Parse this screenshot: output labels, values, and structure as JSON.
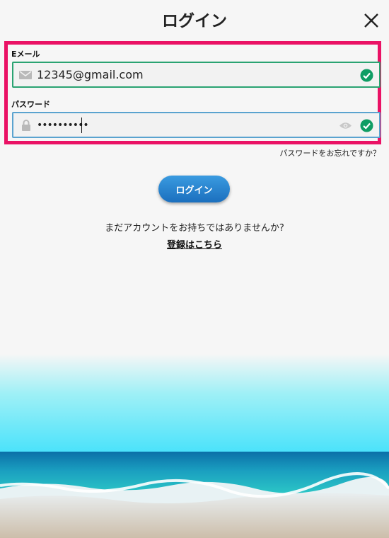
{
  "header": {
    "title": "ログイン"
  },
  "form": {
    "email": {
      "label": "Eメール",
      "value": "12345@gmail.com"
    },
    "password": {
      "label": "パスワード",
      "value": "••••••••••"
    },
    "forgot_label": "パスワードをお忘れですか？",
    "login_label": "ログイン"
  },
  "signup": {
    "prompt": "まだアカウントをお持ちではありませんか?",
    "link_label": "登録はこちら"
  },
  "icons": [
    "close-icon",
    "mail-icon",
    "lock-icon",
    "eye-icon",
    "check-circle-icon"
  ],
  "colors": {
    "highlight": "#ea1265",
    "valid": "#0f9d64",
    "button": "#2c86d3"
  }
}
